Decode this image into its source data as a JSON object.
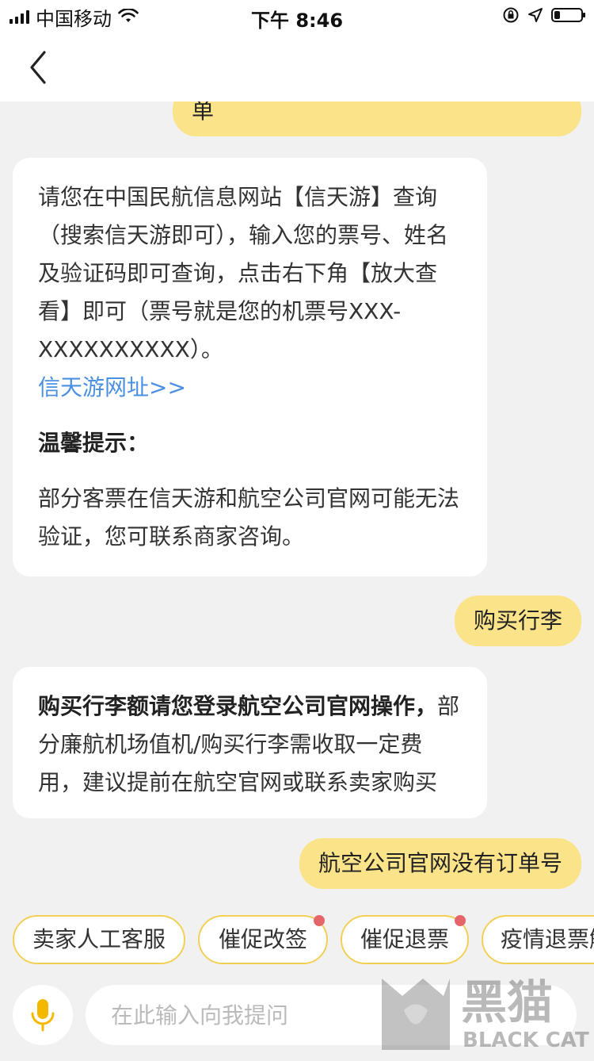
{
  "status_bar": {
    "carrier": "中国移动",
    "time": "下午 8:46",
    "battery_level": 0.22
  },
  "nav": {
    "back_icon": "chevron-left-icon"
  },
  "chat": {
    "messages": [
      {
        "role": "user",
        "text": "单"
      },
      {
        "role": "bot",
        "text": "请您在中国民航信息网站【信天游】查询（搜索信天游即可），输入您的票号、姓名及验证码即可查询，点击右下角【放大查看】即可（票号就是您的机票号XXX-XXXXXXXXXX）。",
        "link": "信天游网址>>",
        "tip_title": "温馨提示：",
        "tip_text": "部分客票在信天游和航空公司官网可能无法验证，您可联系商家咨询。"
      },
      {
        "role": "user",
        "text": "购买行李"
      },
      {
        "role": "bot",
        "bold_text": "购买行李额请您登录航空公司官网操作，",
        "text": "部分廉航机场值机/购买行李需收取一定费用，建议提前在航空官网或联系卖家购买"
      },
      {
        "role": "user",
        "text": "航空公司官网没有订单号"
      }
    ]
  },
  "quick_replies": [
    {
      "label": "卖家人工客服",
      "dot": false
    },
    {
      "label": "催促改签",
      "dot": true
    },
    {
      "label": "催促退票",
      "dot": true
    },
    {
      "label": "疫情退票解",
      "dot": false
    }
  ],
  "input": {
    "placeholder": "在此输入向我提问",
    "mic_icon": "microphone-icon"
  },
  "watermark": {
    "text_cn": "黑猫",
    "text_en": "BLACK CAT"
  },
  "colors": {
    "accent": "#fbe38a",
    "chip_border": "#f3cf55",
    "link": "#4a90e2",
    "dot": "#e5666a",
    "mic": "#f5b800",
    "background": "#f1f1f1"
  }
}
